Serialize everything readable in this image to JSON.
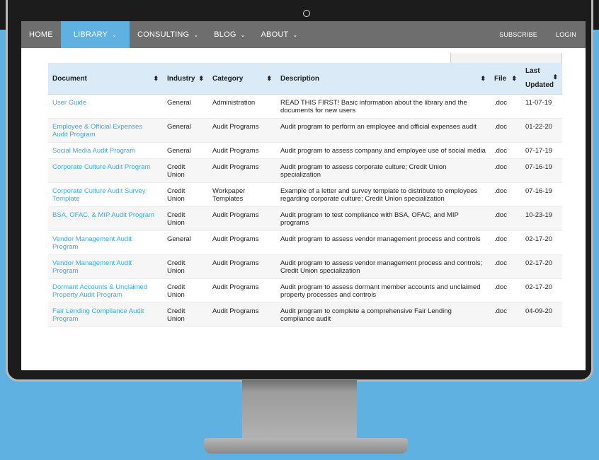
{
  "nav": {
    "items": [
      {
        "label": "HOME",
        "chevron": false,
        "active": false
      },
      {
        "label": "LIBRARY",
        "chevron": true,
        "active": true
      },
      {
        "label": "CONSULTING",
        "chevron": true,
        "active": false
      },
      {
        "label": "BLOG",
        "chevron": true,
        "active": false
      },
      {
        "label": "ABOUT",
        "chevron": true,
        "active": false
      }
    ],
    "right": [
      "SUBSCRIBE",
      "LOGIN"
    ],
    "chevron_glyph": "⌄"
  },
  "table": {
    "headers": {
      "document": "Document",
      "industry": "Industry",
      "category": "Category",
      "description": "Description",
      "file": "File",
      "updated": "Last Updated",
      "sort_glyph": "⬍"
    },
    "rows": [
      {
        "document": "User Guide",
        "industry": "General",
        "category": "Administration",
        "description": "READ THIS FIRST! Basic information about the library and the documents for new users",
        "file": ".doc",
        "updated": "11-07-19"
      },
      {
        "document": "Employee & Official Expenses Audit Program",
        "industry": "General",
        "category": "Audit Programs",
        "description": "Audit program to perform an employee and official expenses audit",
        "file": ".doc",
        "updated": "01-22-20"
      },
      {
        "document": "Social Media Audit Program",
        "industry": "General",
        "category": "Audit Programs",
        "description": "Audit program to assess company and employee use of social media",
        "file": ".doc",
        "updated": "07-17-19"
      },
      {
        "document": "Corporate Culture Audit Program",
        "industry": "Credit Union",
        "category": "Audit Programs",
        "description": "Audit program to assess corporate culture; Credit Union specialization",
        "file": ".doc",
        "updated": "07-16-19"
      },
      {
        "document": "Corporate Culture Audit Survey Template",
        "industry": "Credit Union",
        "category": "Workpaper Templates",
        "description": "Example of a letter and survey template to distribute to employees regarding corporate culture; Credit Union specialization",
        "file": ".doc",
        "updated": "07-16-19"
      },
      {
        "document": "BSA, OFAC, & MIP Audit Program",
        "industry": "Credit Union",
        "category": "Audit Programs",
        "description": "Audit program to test compliance with BSA, OFAC, and MIP programs",
        "file": ".doc",
        "updated": "10-23-19"
      },
      {
        "document": "Vendor Management Audit Program",
        "industry": "General",
        "category": "Audit Programs",
        "description": "Audit program to assess vendor management process and controls",
        "file": ".doc",
        "updated": "02-17-20"
      },
      {
        "document": "Vendor Management Audit Program",
        "industry": "Credit Union",
        "category": "Audit Programs",
        "description": "Audit program to assess vendor management process and controls; Credit Union specialization",
        "file": ".doc",
        "updated": "02-17-20"
      },
      {
        "document": "Dormant Accounts & Unclaimed Property Audit Program",
        "industry": "Credit Union",
        "category": "Audit Programs",
        "description": "Audit program to assess dormant member accounts and unclaimed property processes and controls",
        "file": ".doc",
        "updated": "02-17-20"
      },
      {
        "document": "Fair Lending Compliance Audit Program",
        "industry": "Credit Union",
        "category": "Audit Programs",
        "description": "Audit program to complete a comprehensive Fair Lending compliance audit",
        "file": ".doc",
        "updated": "04-09-20"
      }
    ]
  }
}
